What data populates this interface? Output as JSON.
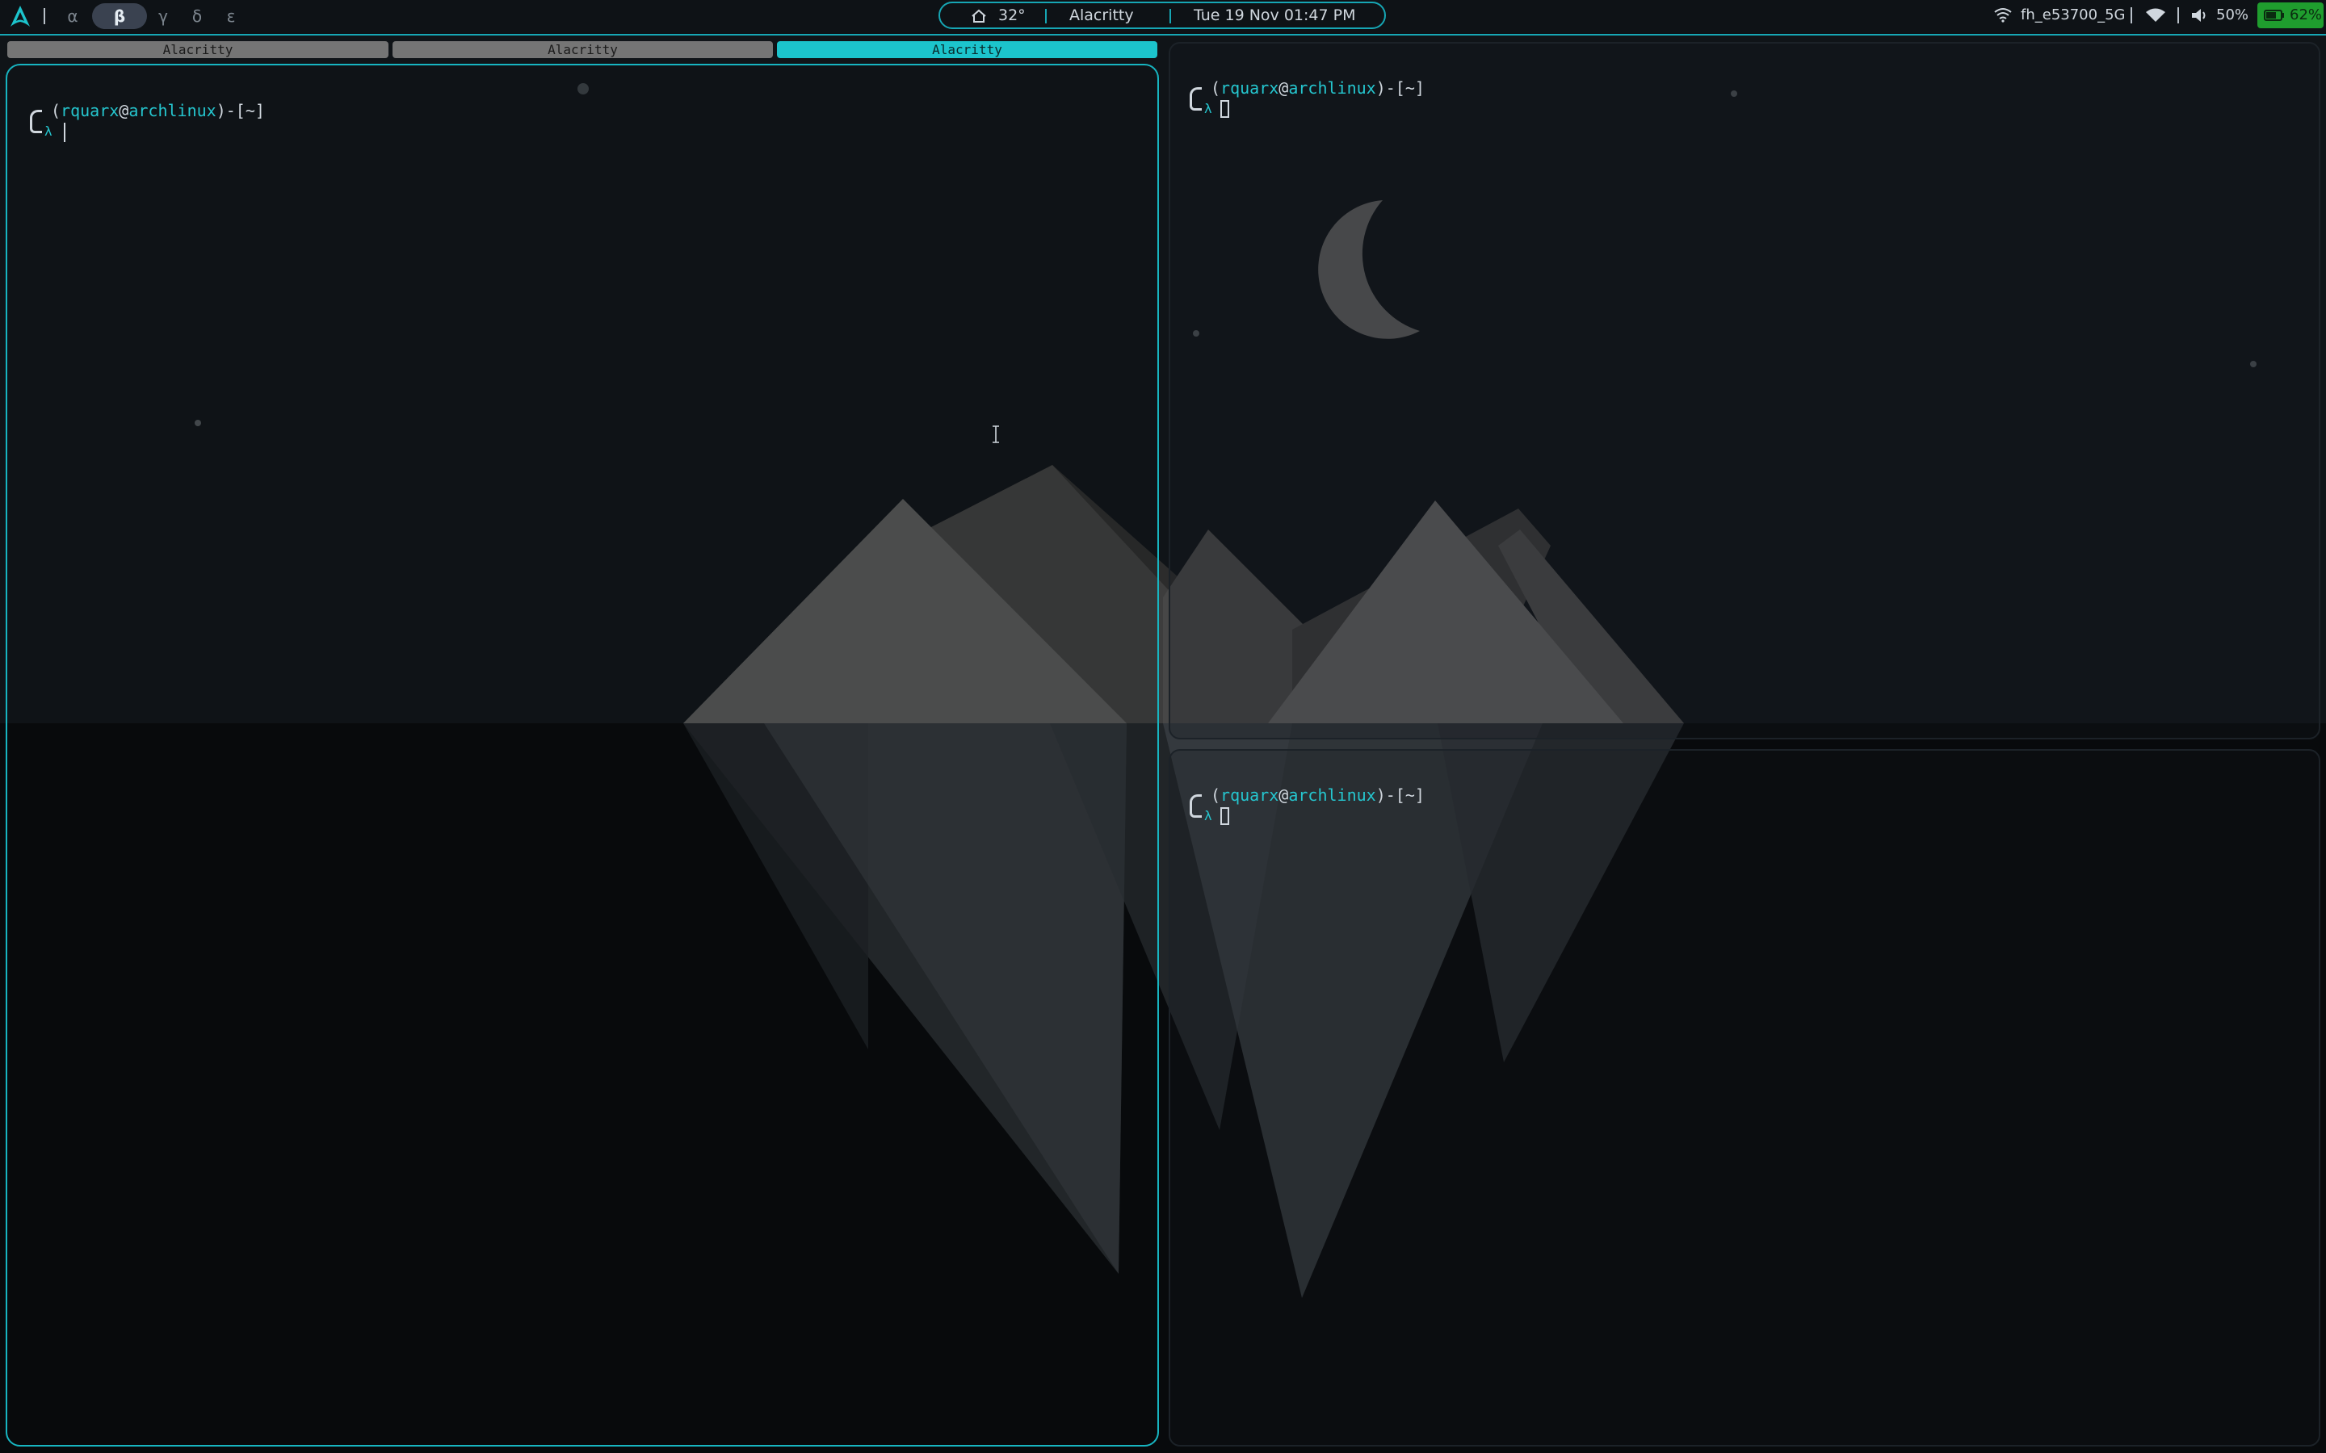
{
  "topbar": {
    "workspaces": [
      {
        "label": "α",
        "active": false
      },
      {
        "label": "β",
        "active": true
      },
      {
        "label": "γ",
        "active": false
      },
      {
        "label": "δ",
        "active": false
      },
      {
        "label": "ε",
        "active": false
      }
    ],
    "weather_icon": "home-icon",
    "weather": "32°",
    "active_window": "Alacritty",
    "datetime": "Tue 19 Nov 01:47 PM",
    "wifi_icon": "wifi-icon",
    "network": "fh_e53700_5G",
    "signal_icon": "wifi-signal-icon",
    "volume_icon": "speaker-icon",
    "volume": "50%",
    "battery_icon": "battery-icon",
    "battery": "62%"
  },
  "tabs": [
    {
      "label": "Alacritty",
      "active": false
    },
    {
      "label": "Alacritty",
      "active": false
    },
    {
      "label": "Alacritty",
      "active": true
    }
  ],
  "terminals": {
    "left": {
      "user": "rquarx",
      "at": "@",
      "host": "archlinux",
      "dir": "~",
      "symbol": "λ"
    },
    "top_right": {
      "user": "rquarx",
      "at": "@",
      "host": "archlinux",
      "dir": "~",
      "symbol": "λ"
    },
    "bottom_right": {
      "user": "rquarx",
      "at": "@",
      "host": "archlinux",
      "dir": "~",
      "symbol": "λ"
    }
  },
  "colors": {
    "accent": "#17b5c1",
    "active_tab": "#1cc4cc",
    "inactive_tab": "#757575",
    "battery_bg": "#1f9d2e",
    "background": "#0b0e11"
  }
}
